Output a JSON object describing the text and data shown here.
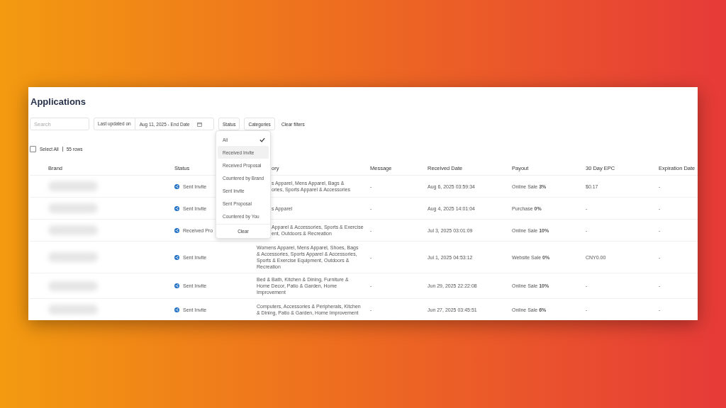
{
  "page_title": "Applications",
  "filters": {
    "search_placeholder": "Search",
    "date_label": "Last updated on",
    "date_value": "Aug 11, 2025 - End Date",
    "buttons": [
      "Status",
      "Categories"
    ],
    "clear": "Clear filters"
  },
  "status_menu": {
    "options": [
      {
        "label": "All",
        "selected": true,
        "highlighted": false
      },
      {
        "label": "Received Invite",
        "selected": false,
        "highlighted": true
      },
      {
        "label": "Received Proposal",
        "selected": false,
        "highlighted": false
      },
      {
        "label": "Countered by Brand",
        "selected": false,
        "highlighted": false
      },
      {
        "label": "Sent Invite",
        "selected": false,
        "highlighted": false
      },
      {
        "label": "Sent Proposal",
        "selected": false,
        "highlighted": false
      },
      {
        "label": "Countered by You",
        "selected": false,
        "highlighted": false
      }
    ],
    "clear": "Clear"
  },
  "select_all": {
    "label": "Select All",
    "checked": false,
    "count": "55 rows"
  },
  "table": {
    "columns": [
      "Brand",
      "Status",
      "ory",
      "Message",
      "Received Date",
      "Payout",
      "30 Day EPC",
      "Expiration Date"
    ],
    "rows": [
      {
        "status": "Sent Invite",
        "category": "s Apparel, Mens Apparel, Bags &\nories, Sports Apparel & Accessories",
        "category_partly_hidden": true,
        "message": "-",
        "received": "Aug 6, 2025 03:59:34",
        "payout": "Online Sale **3%**",
        "epc": "$0.17",
        "expiration": "-"
      },
      {
        "status": "Sent Invite",
        "category": "s Apparel",
        "category_partly_hidden": true,
        "message": "-",
        "received": "Aug 4, 2025 14:01:04",
        "payout": "Purchase **0%**",
        "epc": "-",
        "expiration": "-"
      },
      {
        "status": "Received Pro",
        "category": "Apparel & Accessories, Sports & Exercise\nent, Outdoors & Recreation",
        "category_partly_hidden": true,
        "message": "-",
        "received": "Jul 3, 2025 03:01:09",
        "payout": "Online Sale **10%**",
        "epc": "-",
        "expiration": "-"
      },
      {
        "status": "Sent Invite",
        "category": "Womens Apparel, Mens Apparel, Shoes, Bags & Accessories, Sports Apparel & Accessories, Sports & Exercise Equipment, Outdoors & Recreation",
        "category_partly_hidden": false,
        "message": "-",
        "received": "Jul 1, 2025 04:53:12",
        "payout": "Website Sale **0%**",
        "epc": "CNY0.00",
        "expiration": "-"
      },
      {
        "status": "Sent Invite",
        "category": "Bed & Bath, Kitchen & Dining, Furniture & Home Decor, Patio & Garden, Home Improvement",
        "category_partly_hidden": false,
        "message": "-",
        "received": "Jun 29, 2025 22:22:08",
        "payout": "Online Sale **10%**",
        "epc": "-",
        "expiration": "-"
      },
      {
        "status": "Sent Invite",
        "category": "Computers, Accessories & Peripherals, Kitchen & Dining, Patio & Garden, Home Improvement",
        "category_partly_hidden": false,
        "message": "-",
        "received": "Jun 27, 2025 03:45:51",
        "payout": "Online Sale **6%**",
        "epc": "-",
        "expiration": "-"
      }
    ]
  }
}
